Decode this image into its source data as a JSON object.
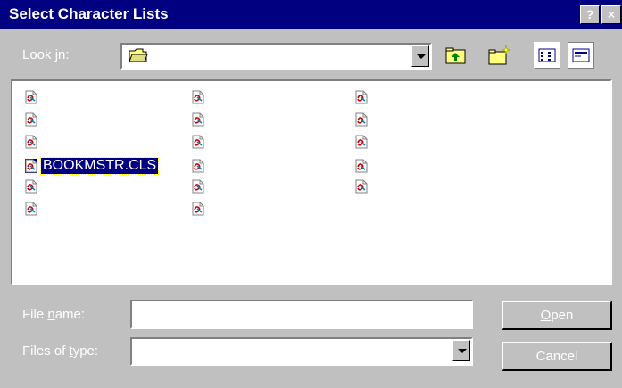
{
  "window": {
    "title": "Select Character Lists",
    "help_label": "?",
    "close_label": "×"
  },
  "lookin": {
    "label_prefix": "Look ",
    "label_accel": "j",
    "label_suffix": "n:",
    "value": ""
  },
  "files": {
    "selected_name": "BOOKMSTR.CLS"
  },
  "filename": {
    "label_prefix": "File ",
    "label_accel": "n",
    "label_suffix": "ame:",
    "value": ""
  },
  "filetype": {
    "label_prefix": "Files of ",
    "label_accel": "t",
    "label_suffix": "ype:",
    "value": ""
  },
  "buttons": {
    "open_accel": "O",
    "open_rest": "pen",
    "cancel": "Cancel"
  },
  "colors": {
    "titlebar": "#000080",
    "face": "#c0c0c0",
    "selection": "#000080"
  }
}
